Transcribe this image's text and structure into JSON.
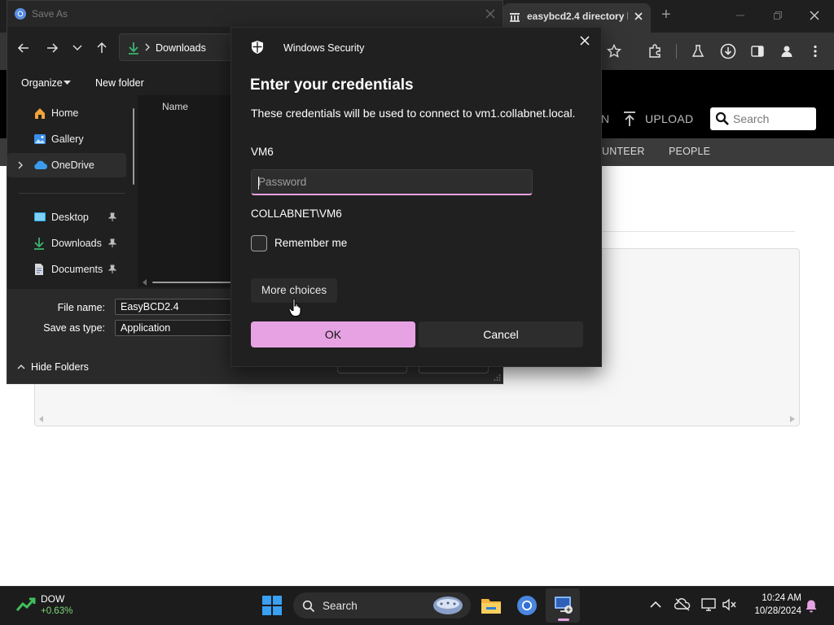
{
  "browser": {
    "tab_title": "easybcd2.4 directory l",
    "new_tab": "+",
    "site": {
      "login_fragment": "N",
      "upload": "UPLOAD",
      "search_placeholder": "Search",
      "nav_volunteer": "UNTEER",
      "nav_people": "PEOPLE"
    }
  },
  "saveas": {
    "title": "Save As",
    "address": "Downloads",
    "commands": {
      "organize": "Organize",
      "new_folder": "New folder"
    },
    "nav_items": [
      {
        "label": "Home",
        "icon": "home-icon"
      },
      {
        "label": "Gallery",
        "icon": "gallery-icon"
      },
      {
        "label": "OneDrive",
        "icon": "onedrive-icon"
      },
      {
        "label": "Desktop",
        "icon": "desktop-icon"
      },
      {
        "label": "Downloads",
        "icon": "download-icon"
      },
      {
        "label": "Documents",
        "icon": "documents-icon"
      }
    ],
    "column_header": "Name",
    "file_name_label": "File name:",
    "file_name_value": "EasyBCD2.4",
    "save_type_label": "Save as type:",
    "save_type_value": "Application",
    "hide_folders": "Hide Folders"
  },
  "winsec": {
    "app_name": "Windows Security",
    "heading": "Enter your credentials",
    "description": "These credentials will be used to connect to vm1.collabnet.local.",
    "username": "VM6",
    "password_placeholder": "Password",
    "domain_user": "COLLABNET\\VM6",
    "remember_label": "Remember me",
    "more_choices": "More choices",
    "ok": "OK",
    "cancel": "Cancel",
    "accent_color": "#e7a2e3"
  },
  "taskbar": {
    "widget_name": "DOW",
    "widget_change": "+0.63%",
    "search_label": "Search",
    "time": "10:24 AM",
    "date": "10/28/2024"
  }
}
